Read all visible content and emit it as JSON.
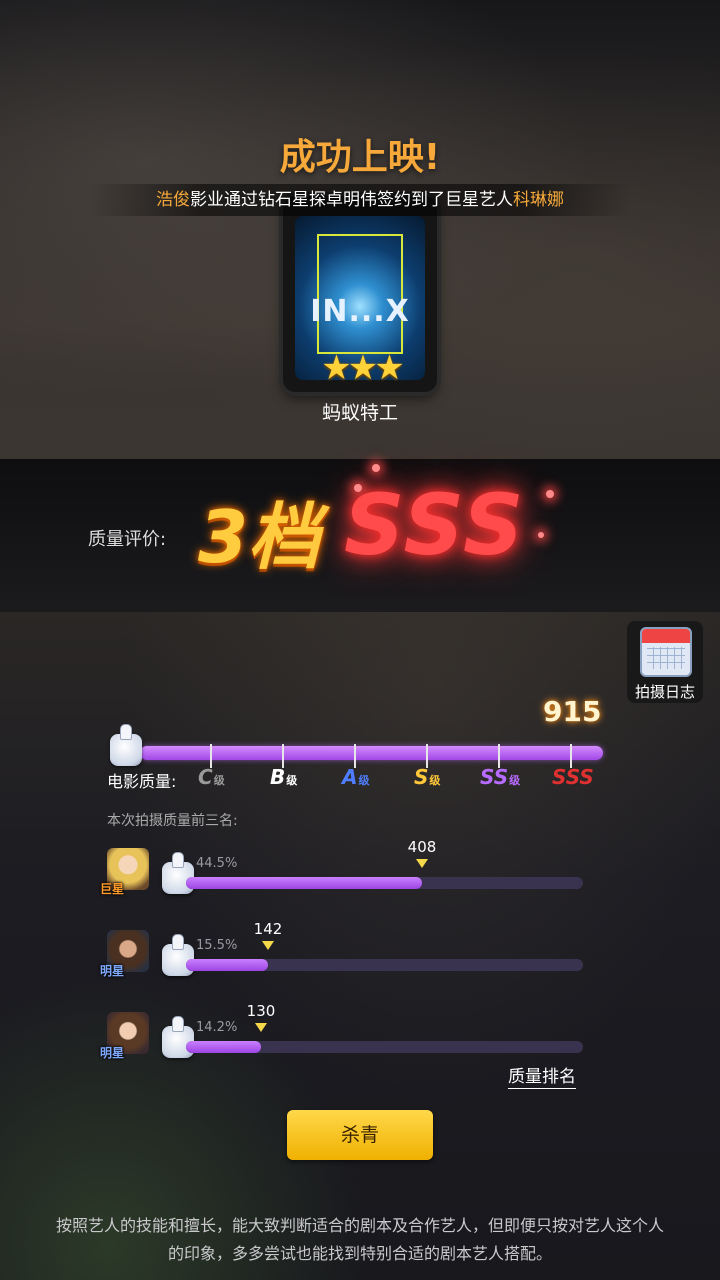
{
  "header": {
    "title": "成功上映!",
    "subtitle_parts": {
      "company": "浩俊",
      "middle": "影业通过钻石星探卓明伟签约到了巨星艺人",
      "artist": "科琳娜"
    }
  },
  "movie": {
    "poster_text": "IN...X",
    "stars": 3,
    "stars_text": "★★★",
    "name": "蚂蚁特工"
  },
  "quality": {
    "label": "质量评价:",
    "tier": "3档",
    "grade": "SSS"
  },
  "log_button": {
    "label": "拍摄日志",
    "icon": "calendar-icon"
  },
  "film_quality": {
    "score": "915",
    "label": "电影质量:",
    "grades": [
      {
        "letter": "C",
        "suffix": "级",
        "color": "#9a9a9a"
      },
      {
        "letter": "B",
        "suffix": "级",
        "color": "#ffffff"
      },
      {
        "letter": "A",
        "suffix": "级",
        "color": "#4f7dff"
      },
      {
        "letter": "S",
        "suffix": "级",
        "color": "#ffc83a"
      },
      {
        "letter": "SS",
        "suffix": "级",
        "color": "#b86bff"
      },
      {
        "letter": "SSS",
        "suffix": "",
        "color": "#e03030"
      }
    ]
  },
  "top3": {
    "title": "本次拍摄质量前三名:",
    "rows": [
      {
        "tag": "巨星",
        "tag_color": "#ff9a2a",
        "percent": "44.5%",
        "value": "408",
        "fill": 0.595
      },
      {
        "tag": "明星",
        "tag_color": "#7fa8ff",
        "percent": "15.5%",
        "value": "142",
        "fill": 0.207
      },
      {
        "tag": "明星",
        "tag_color": "#7fa8ff",
        "percent": "14.2%",
        "value": "130",
        "fill": 0.189
      }
    ]
  },
  "rank_link": "质量排名",
  "wrap_button": "杀青",
  "tip": "按照艺人的技能和擅长，能大致判断适合的剧本及合作艺人，但即便只按对艺人这个人的印象，多多尝试也能找到特别合适的剧本艺人搭配。"
}
